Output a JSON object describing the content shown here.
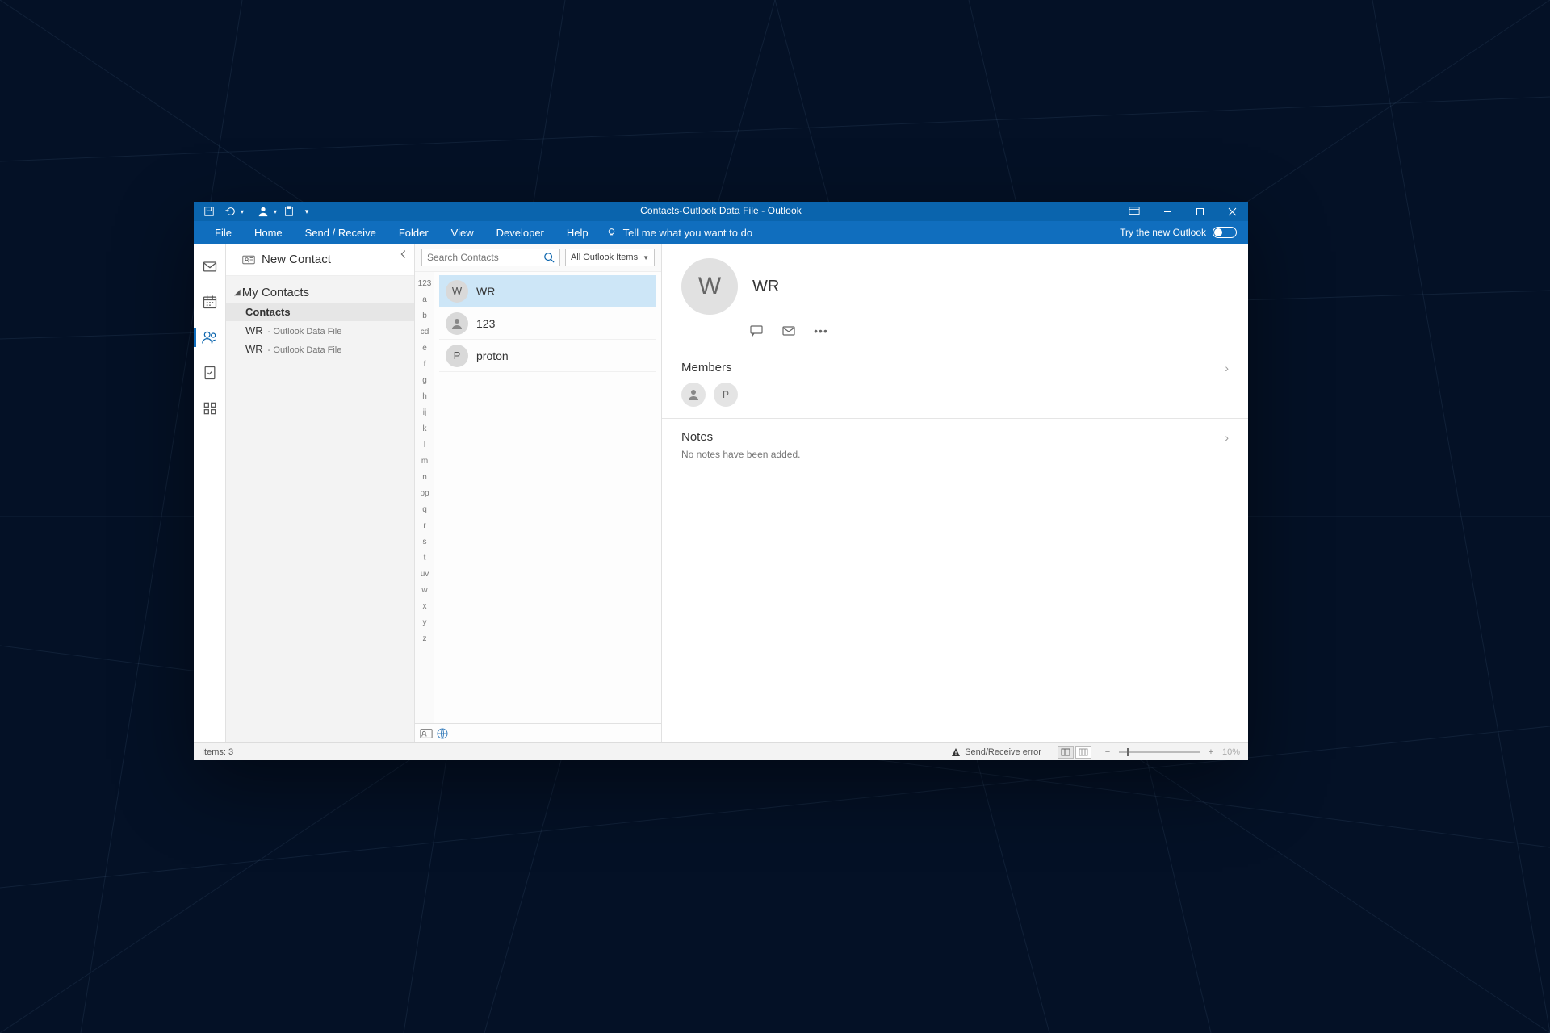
{
  "titlebar": {
    "title": "Contacts-Outlook Data File  -  Outlook"
  },
  "menubar": {
    "items": [
      "File",
      "Home",
      "Send / Receive",
      "Folder",
      "View",
      "Developer",
      "Help"
    ],
    "tellme": "Tell me what you want to do",
    "try_new": "Try the new Outlook"
  },
  "folder_pane": {
    "new_button": "New Contact",
    "section": "My Contacts",
    "items": [
      {
        "label": "Contacts",
        "sub": "",
        "bold": true
      },
      {
        "label": "WR",
        "sub": "- Outlook Data File",
        "bold": false
      },
      {
        "label": "WR",
        "sub": "- Outlook Data File",
        "bold": false
      }
    ]
  },
  "list_col": {
    "search_placeholder": "Search Contacts",
    "scope": "All Outlook Items",
    "az_index": [
      "123",
      "a",
      "b",
      "cd",
      "e",
      "f",
      "g",
      "h",
      "ij",
      "k",
      "l",
      "m",
      "n",
      "op",
      "q",
      "r",
      "s",
      "t",
      "uv",
      "w",
      "x",
      "y",
      "z"
    ],
    "contacts": [
      {
        "initial": "W",
        "name": "WR",
        "selected": true,
        "icon": "initial"
      },
      {
        "initial": "",
        "name": "123",
        "selected": false,
        "icon": "person"
      },
      {
        "initial": "P",
        "name": "proton",
        "selected": false,
        "icon": "initial"
      }
    ]
  },
  "reading": {
    "name": "WR",
    "avatar_initial": "W",
    "members_title": "Members",
    "notes_title": "Notes",
    "notes_text": "No notes have been added.",
    "members": [
      {
        "type": "person-icon"
      },
      {
        "type": "initial",
        "initial": "P"
      }
    ]
  },
  "statusbar": {
    "items_label": "Items: 3",
    "error_label": "Send/Receive error",
    "zoom_label": "10%"
  }
}
